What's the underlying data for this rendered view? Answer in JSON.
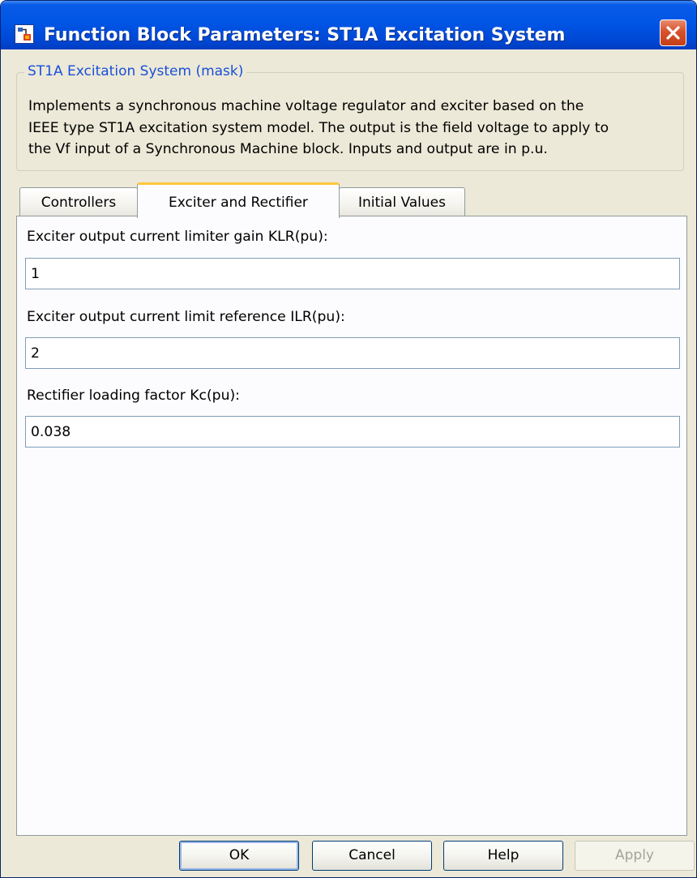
{
  "window": {
    "title": "Function Block Parameters: ST1A Excitation System",
    "title_bar_color": "#0055e5",
    "close_icon": "close-icon",
    "app_icon": "simulink-block-icon"
  },
  "mask": {
    "group_title": "ST1A Excitation System (mask)",
    "description_lines": [
      "Implements a synchronous machine voltage regulator and exciter based on the",
      "IEEE type ST1A excitation system model. The output is the field voltage to apply to",
      "the Vf input of a Synchronous Machine block. Inputs and output are in p.u."
    ],
    "legend_color": "#1a4fd8"
  },
  "tabs": [
    {
      "label": "Controllers",
      "active": false
    },
    {
      "label": "Exciter and Rectifier",
      "active": true
    },
    {
      "label": "Initial Values",
      "active": false
    }
  ],
  "params": [
    {
      "label": "Exciter output current limiter gain KLR(pu):",
      "value": "1"
    },
    {
      "label": "Exciter output current limit reference ILR(pu):",
      "value": "2"
    },
    {
      "label": "Rectifier loading factor Kc(pu):",
      "value": "0.038"
    }
  ],
  "buttons": {
    "ok": "OK",
    "cancel": "Cancel",
    "help": "Help",
    "apply": "Apply",
    "apply_enabled": false
  },
  "colors": {
    "active_tab_accent": "#ffc83c",
    "dialog_background": "#ece9d8",
    "panel_background": "#fcfcfe"
  }
}
